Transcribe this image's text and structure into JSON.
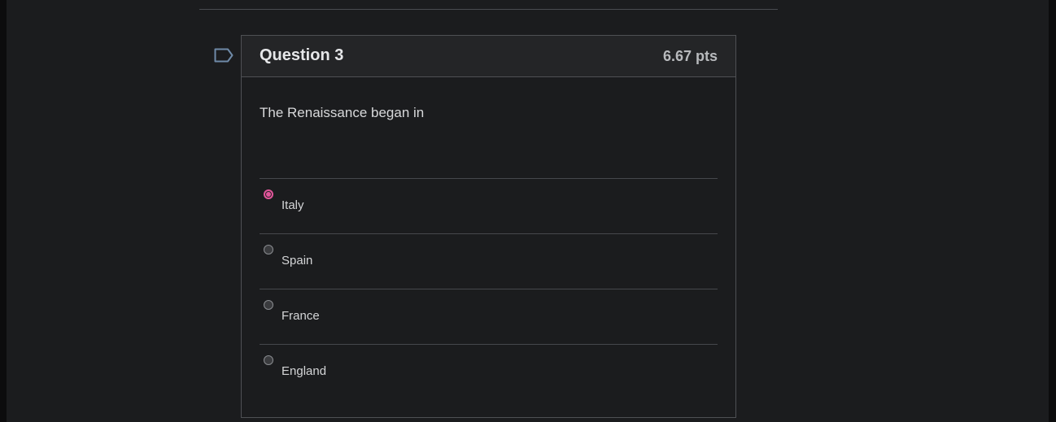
{
  "question": {
    "title": "Question 3",
    "points": "6.67 pts",
    "prompt": "The Renaissance began in",
    "flag_icon": "flag-outline-icon"
  },
  "answers": [
    {
      "label": "Italy",
      "selected": true
    },
    {
      "label": "Spain",
      "selected": false
    },
    {
      "label": "France",
      "selected": false
    },
    {
      "label": "England",
      "selected": false
    }
  ],
  "colors": {
    "background": "#1b1c1e",
    "header": "#242527",
    "border": "#4e5054",
    "accent_selected": "#e0559a",
    "flag_icon": "#6f8aa8"
  }
}
